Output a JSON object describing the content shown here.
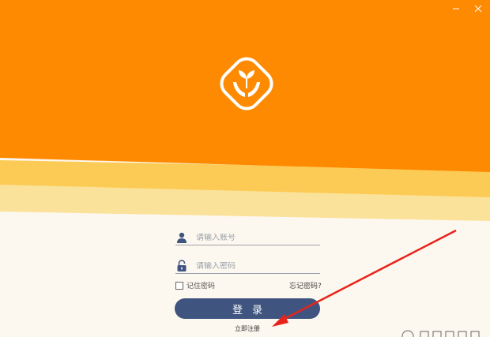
{
  "window": {
    "minimize_icon": "minimize-icon",
    "close_icon": "close-icon"
  },
  "colors": {
    "header_orange": "#fe8a02",
    "wave_yellow": "#fccb55",
    "wave_light": "#fbe29a",
    "background": "#fdf8ef",
    "login_button": "#3f5580",
    "arrow": "#e8231c"
  },
  "logo": {
    "icon": "hands-sprout-logo"
  },
  "login_form": {
    "username_placeholder": "请输入账号",
    "password_placeholder": "请输入密码",
    "remember_label": "记住密码",
    "forgot_label": "忘记密码?",
    "login_label": "登录",
    "register_label": "立即注册"
  }
}
